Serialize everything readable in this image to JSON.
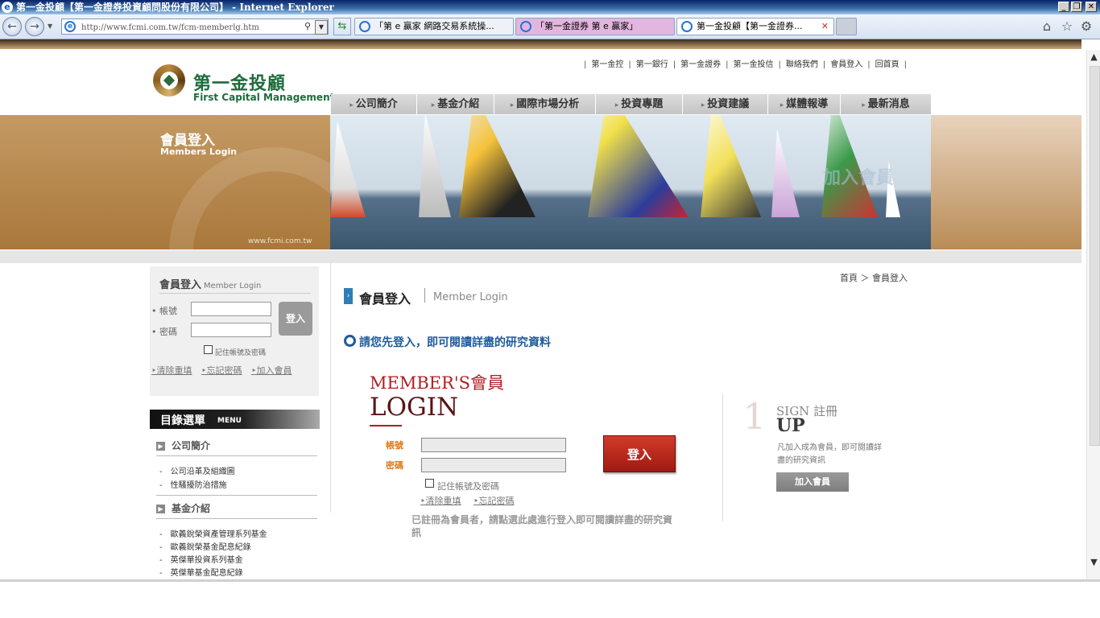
{
  "window": {
    "title": "第一金投顧【第一金證券投資顧問股份有限公司】 - Internet Explorer",
    "minimize": "_",
    "restore": "❐",
    "close": "✕"
  },
  "browser": {
    "url": "http://www.fcmi.com.tw/fcm-memberlg.htm",
    "tabs": [
      {
        "label": "「第 e 贏家 網路交易系統操...",
        "active": false
      },
      {
        "label": "「第一金證券 第 e 贏家」",
        "active": false
      },
      {
        "label": "第一金投顧【第一金證券...",
        "active": true
      }
    ],
    "tab_close": "✕"
  },
  "site": {
    "logo_cn": "第一金投顧",
    "logo_en": "First Capital Management",
    "top_links": [
      "第一金控",
      "第一銀行",
      "第一金證券",
      "第一金投信",
      "聯絡我們",
      "會員登入",
      "回首頁"
    ],
    "nav": [
      "公司簡介",
      "基金介紹",
      "國際市場分析",
      "投資專題",
      "投資建議",
      "媒體報導",
      "最新消息"
    ],
    "banner_cn": "會員登入",
    "banner_en": "Members Login",
    "banner_url": "www.fcmi.com.tw",
    "banner_join": "加入會員"
  },
  "sidebar_login": {
    "title": "會員登入",
    "title_en": "Member Login",
    "account_label": "帳號",
    "password_label": "密碼",
    "login_button": "登入",
    "remember": "記住帳號及密碼",
    "links": [
      "清除重填",
      "忘記密碼",
      "加入會員"
    ]
  },
  "menu": {
    "title": "目錄選單",
    "title_en": "MENU",
    "sections": [
      {
        "label": "公司簡介",
        "items": [
          "公司沿革及組織圖",
          "性騷擾防治措施"
        ]
      },
      {
        "label": "基金介紹",
        "items": [
          "歐義銳榮資產管理系列基金",
          "歐義銳榮基金配息紀錄",
          "英傑華投資系列基金",
          "英傑華基金配息紀錄"
        ]
      }
    ]
  },
  "main": {
    "breadcrumb": "首頁 ＞ 會員登入",
    "title_cn": "會員登入",
    "title_en": "Member Login",
    "notice": "請您先登入，即可閱讀詳盡的研究資料",
    "member_title1": "MEMBER'S會員",
    "member_title2": "LOGIN",
    "account_label": "帳號",
    "password_label": "密碼",
    "login_button": "登入",
    "remember": "記住帳號及密碼",
    "links": [
      "清除重填",
      "忘記密碼"
    ],
    "registered_note": "已註冊為會員者，請點選此處進行登入即可閱讀詳盡的研究資訊",
    "signup_num": "1",
    "signup_sign": "SIGN 註冊",
    "signup_up": "UP",
    "signup_text": "凡加入成為會員，即可閱讀詳盡的研究資訊",
    "join_button": "加入會員"
  }
}
